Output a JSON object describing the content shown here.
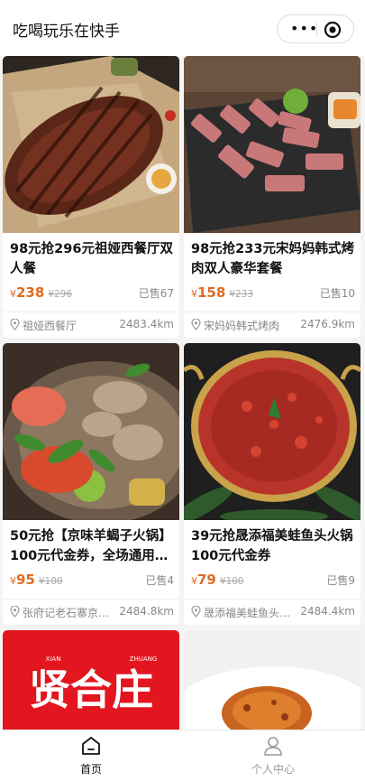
{
  "header": {
    "title": "吃喝玩乐在快手",
    "more_icon": "more-dots-icon",
    "close_icon": "target-close-icon"
  },
  "products": [
    {
      "name": "98元抢296元祖娅西餐厅双人餐",
      "yen": "¥",
      "price": "238",
      "orig": "¥296",
      "sold": "已售67",
      "shop": "祖娅西餐厅",
      "dist": "2483.4km"
    },
    {
      "name": "98元抢233元宋妈妈韩式烤肉双人豪华套餐",
      "yen": "¥",
      "price": "158",
      "orig": "¥233",
      "sold": "已售10",
      "shop": "宋妈妈韩式烤肉",
      "dist": "2476.9km"
    },
    {
      "name": "50元抢【京味羊蝎子火锅】100元代金券，全场通用…",
      "yen": "¥",
      "price": "95",
      "orig": "¥100",
      "sold": "已售4",
      "shop": "张府记老石寨京…",
      "dist": "2484.8km"
    },
    {
      "name": "39元抢晟添福美蛙鱼头火锅100元代金券",
      "yen": "¥",
      "price": "79",
      "orig": "¥100",
      "sold": "已售9",
      "shop": "晟添福美蛙鱼头…",
      "dist": "2484.4km"
    },
    {
      "name": "",
      "logo_text": "贤合庄",
      "logo_small_left": "XIAN",
      "logo_small_right": "ZHUANG"
    },
    {
      "name": ""
    }
  ],
  "tabs": [
    {
      "label": "首页",
      "icon": "home-icon"
    },
    {
      "label": "个人中心",
      "icon": "user-icon"
    }
  ],
  "colors": {
    "accent": "#e26a22",
    "text": "#111111",
    "muted": "#888888"
  }
}
